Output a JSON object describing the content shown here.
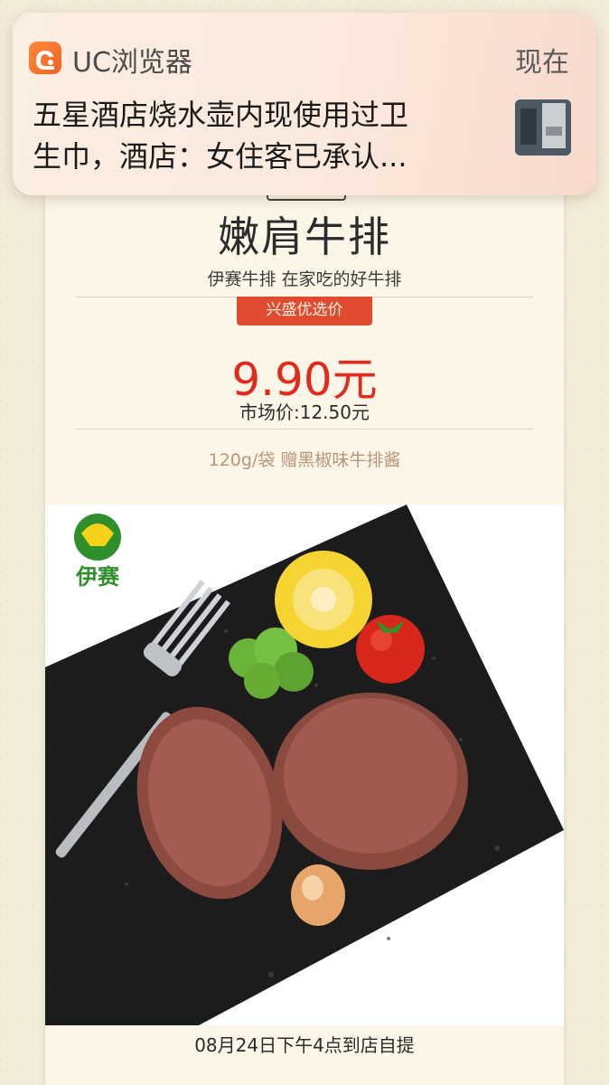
{
  "notification": {
    "app_name": "UC浏览器",
    "app_icon": "uc-browser-icon",
    "time": "现在",
    "line1": "五星酒店烧水壶内现使用过卫",
    "line2": "生巾，酒店：女住客已承认..."
  },
  "product": {
    "title": "嫩肩牛排",
    "subtitle": "伊赛牛排 在家吃的好牛排",
    "promo_badge": "兴盛优选价",
    "price": "9.90元",
    "market_price": "市场价:12.50元",
    "spec": "120g/袋 赠黑椒味牛排酱",
    "image_logo_text": "伊赛",
    "pickup_note": "08月24日下午4点到店自提"
  },
  "colors": {
    "price": "#e02a1c",
    "promo_badge_bg": "#e04a2e",
    "card_bg": "#fbf6e8",
    "page_bg": "#f3ecd9"
  }
}
